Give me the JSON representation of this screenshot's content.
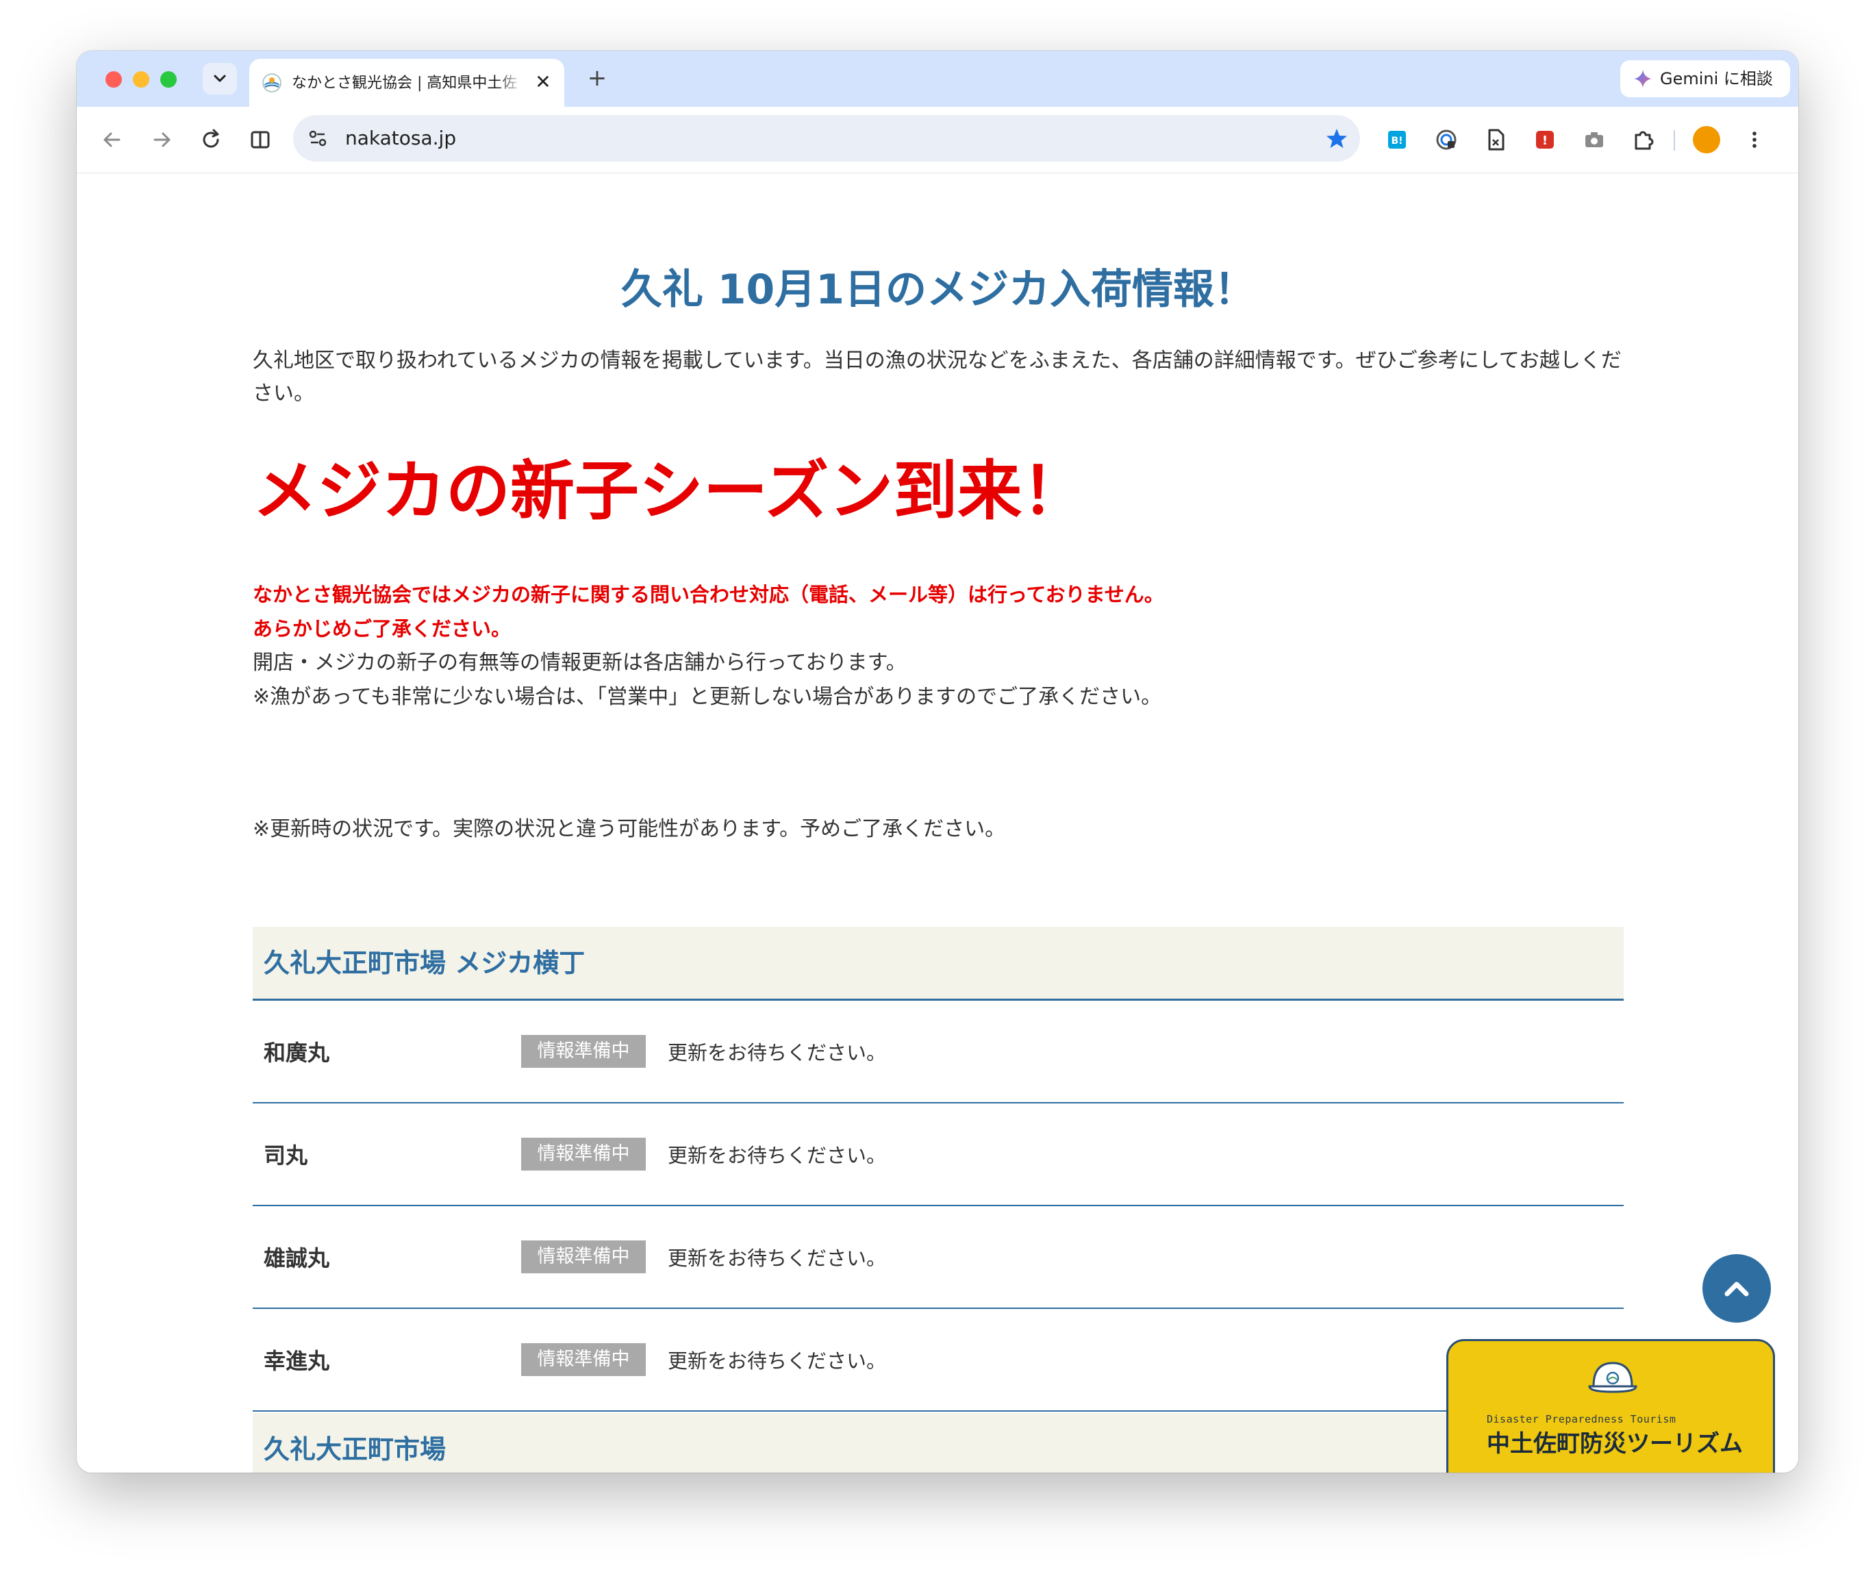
{
  "browser": {
    "tab_title": "なかとさ観光協会 | 高知県中土佐",
    "tab_close": "✕",
    "new_tab": "+",
    "gemini_label": "Gemini に相談",
    "url": "nakatosa.jp",
    "extensions": [
      "hatena-bookmark-icon",
      "password-icon",
      "page-icon",
      "red-extension-icon",
      "camera-icon",
      "puzzle-icon"
    ],
    "colors": {
      "tabstrip": "#d3e3fd",
      "profile": "#f29900"
    }
  },
  "page": {
    "title": "久礼 10月1日のメジカ入荷情報！",
    "intro": "久礼地区で取り扱われているメジカの情報を掲載しています。当日の漁の状況などをふまえた、各店舗の詳細情報です。ぜひご参考にしてお越しください。",
    "season_headline": "メジカの新子シーズン到来！",
    "red_note_1": "なかとさ観光協会ではメジカの新子に関する問い合わせ対応（電話、メール等）は行っておりません。",
    "red_note_2": "あらかじめご了承ください。",
    "info_1": "開店・メジカの新子の有無等の情報更新は各店舗から行っております。",
    "info_2": "※漁があっても非常に少ない場合は、「営業中」と更新しない場合がありますのでご了承ください。",
    "update_note": "※更新時の状況です。実際の状況と違う可能性があります。予めご了承ください。",
    "sections": [
      {
        "title": "久礼大正町市場 メジカ横丁",
        "rows": [
          {
            "shop": "和廣丸",
            "badge": "情報準備中",
            "message": "更新をお待ちください。"
          },
          {
            "shop": "司丸",
            "badge": "情報準備中",
            "message": "更新をお待ちください。"
          },
          {
            "shop": "雄誠丸",
            "badge": "情報準備中",
            "message": "更新をお待ちください。"
          },
          {
            "shop": "幸進丸",
            "badge": "情報準備中",
            "message": "更新をお待ちください。"
          }
        ]
      },
      {
        "title": "久礼大正町市場"
      }
    ],
    "banner": {
      "en": "Disaster Preparedness Tourism",
      "jp": "中土佐町防災ツーリズム"
    },
    "colors": {
      "heading_blue": "#2e6ea1",
      "alert_red": "#e60000",
      "banner_yellow": "#f0c80f"
    }
  }
}
